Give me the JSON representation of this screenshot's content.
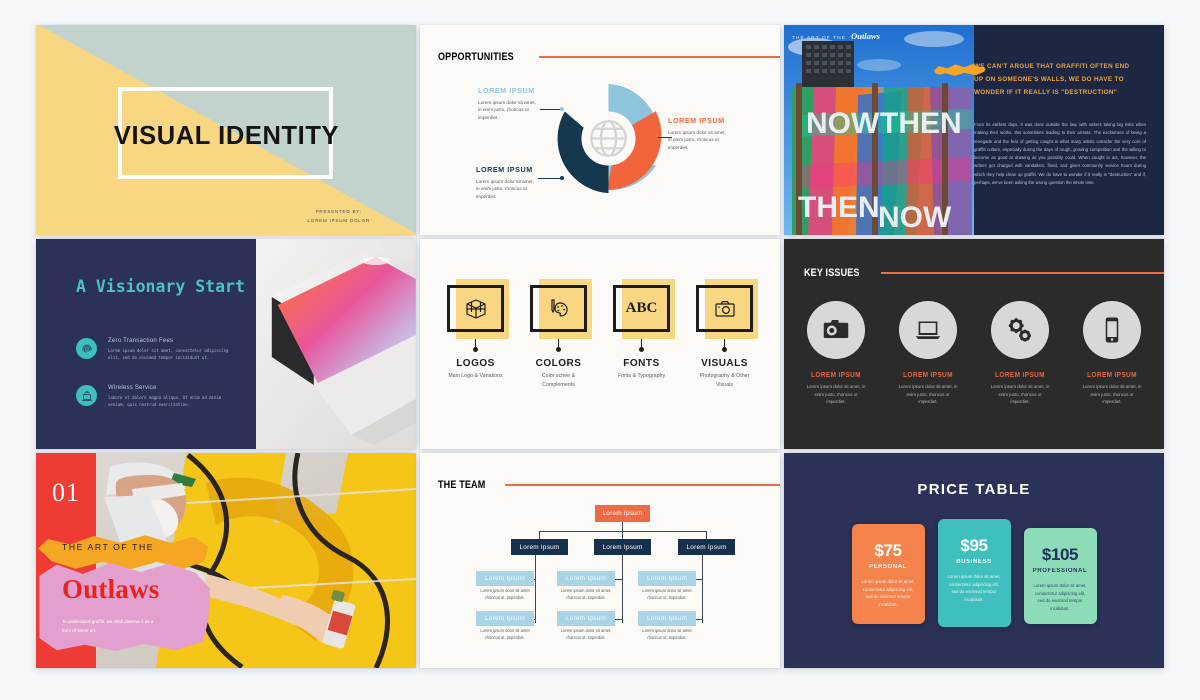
{
  "slide_title": {
    "title": "VISUAL IDENTITY",
    "presented_by_label": "PRESENTED BY:",
    "presenter": "LOREM IPSUM DOLOR",
    "colors": {
      "yellow": "#f9d782",
      "sage": "#c2d3cd",
      "text": "#141414"
    }
  },
  "slide_opportunities": {
    "heading": "OPPORTUNITIES",
    "accent": "#ef6b45",
    "center_icon": "globe-icon",
    "callouts": [
      {
        "title": "LOREM IPSUM",
        "body": "Lorem ipsum dolor sit amet, in enim justo, rhoncus ut imperdiet.",
        "color": "#93c6dd"
      },
      {
        "title": "LOREM IPSUM",
        "body": "Lorem ipsum dolor sit amet, in enim justo, rhoncus ut imperdiet.",
        "color": "#ef6b45"
      },
      {
        "title": "LOREM IPSUM",
        "body": "Lorem ipsum dolor sit amet, in enim justo, rhoncus ut imperdiet.",
        "color": "#16384f"
      }
    ],
    "segment_colors": {
      "light_blue": "#8ec4dc",
      "orange": "#f2653c",
      "navy": "#16384f"
    }
  },
  "slide_article": {
    "overlay_small": "THE ART OF THE",
    "overlay_large": "Outlaws",
    "headline": "WE CAN'T ARGUE THAT GRAFFITI OFTEN END UP ON SOMEONE'S WALLS, WE DO HAVE TO WONDER IF IT REALLY IS \"DESTRUCTION\"",
    "body": "From its earliest days, it was done outside the law, with writers taking big risks when making their works, this sometimes leading to their arrests. The excitement of being a renegade and the fear of getting caught is what many artists consider the very core of graffiti culture, especially during the days of rough, growing competition and the willing to become as good at drawing as you possibly could. When caught in act, however, the writers get charged with vandalism, fined, and given community service hours during which they help clean up graffiti. We do have to wonder if it really is \"destruction\" and if, perhaps, we've been asking the wrong question the whole time.",
    "headline_color": "#f0a33c",
    "background": "#1d2742"
  },
  "slide_visionary": {
    "heading": "A Visionary Start",
    "background": "#2b3157",
    "accent": "#4cc2c4",
    "features": [
      {
        "icon": "fingerprint-icon",
        "title": "Zero Transaction Fees",
        "body": "Lorem ipsum dolor sit amet, consectetur adipiscing elit, sed do eiusmod tempor incididunt ut."
      },
      {
        "icon": "wireless-service-icon",
        "title": "Wireless Service",
        "body": "labore et dolore magna aliqua. Ut enim ad minim veniam, quis nostrud exercitation."
      }
    ]
  },
  "slide_brand_elements": {
    "cards": [
      {
        "icon": "cube-icon",
        "name": "LOGOS",
        "sub": "Main Logo & Variations"
      },
      {
        "icon": "palette-icon",
        "name": "COLORS",
        "sub": "Color schee & Complements"
      },
      {
        "icon": "abc-icon",
        "name": "FONTS",
        "sub": "Fonts & Typography",
        "glyph": "ABC"
      },
      {
        "icon": "camera-icon",
        "name": "VISUALS",
        "sub": "Photography & Other Visuals"
      }
    ],
    "highlight": "#f9d782"
  },
  "slide_key_issues": {
    "heading": "KEY ISSUES",
    "background": "#2b2b2b",
    "accent": "#ef6b45",
    "cards": [
      {
        "icon": "camera-icon",
        "name": "LOREM IPSUM",
        "body": "Lorem ipsum dolor sit amet, in enim justo, rhoncus ut imperdiet."
      },
      {
        "icon": "laptop-icon",
        "name": "LOREM IPSUM",
        "body": "Lorem ipsum dolor sit amet, in enim justo, rhoncus ut imperdiet."
      },
      {
        "icon": "gears-icon",
        "name": "LOREM IPSUM",
        "body": "Lorem ipsum dolor sit amet, in enim justo, rhoncus ut imperdiet."
      },
      {
        "icon": "smartphone-icon",
        "name": "LOREM IPSUM",
        "body": "Lorem ipsum dolor sit amet, in enim justo, rhoncus ut imperdiet."
      }
    ]
  },
  "slide_cover": {
    "number": "01",
    "kicker": "THE ART OF THE",
    "title": "Outlaws",
    "caption": "To understand graffiti, we shall observe it as a form of street art.",
    "colors": {
      "red": "#ee3b33",
      "orange_brush": "#f5a623",
      "pink_brush": "#e3a0ce",
      "title_red": "#e8231e"
    }
  },
  "slide_team": {
    "heading": "THE TEAM",
    "accent": "#ef6b45",
    "root": "Lorem Ipsum",
    "branches": [
      "Lorem Ipsum",
      "Lorem Ipsum",
      "Lorem Ipsum"
    ],
    "leaves": [
      {
        "label": "Lorem Ipsum",
        "caption": "Lorem ipsum dolor sit amet rhoncus ut, imperdiet."
      },
      {
        "label": "Lorem Ipsum",
        "caption": "Lorem ipsum dolor sit amet, rhoncus ut, imperdiet."
      },
      {
        "label": "Lorem Ipsum",
        "caption": "Lorem ipsum dolor sit amet rhoncus ut, imperdiet."
      },
      {
        "label": "Lorem Ipsum",
        "caption": "Lorem ipsum dolor sit amet rhoncus ut, imperdiet."
      },
      {
        "label": "Lorem Ipsum",
        "caption": "Lorem ipsum dolor sit amet, rhoncus ut, imperdiet."
      },
      {
        "label": "Lorem Ipsum",
        "caption": "Lorem ipsum dolor sit amet rhoncus ut, imperdiet."
      }
    ]
  },
  "slide_price": {
    "heading": "PRICE TABLE",
    "background": "#2b3157",
    "plans": [
      {
        "price": "$75",
        "tier": "PERSONAL",
        "desc": "Lorem ipsum dolor sit amet, consectetur adipiscing elit, sed do eiusmod tempor incididunt.",
        "color": "#f5834c"
      },
      {
        "price": "$95",
        "tier": "BUSINESS",
        "desc": "Lorem ipsum dolor sit amet, consectetur adipiscing elit, sed do eiusmod tempor incididunt.",
        "color": "#3fbfbd"
      },
      {
        "price": "$105",
        "tier": "PROFESSIONAL",
        "desc": "Lorem ipsum dolor sit amet, consectetur adipiscing elit, sed do eiusmod tempor incididunt.",
        "color": "#8ddcb8"
      }
    ]
  }
}
